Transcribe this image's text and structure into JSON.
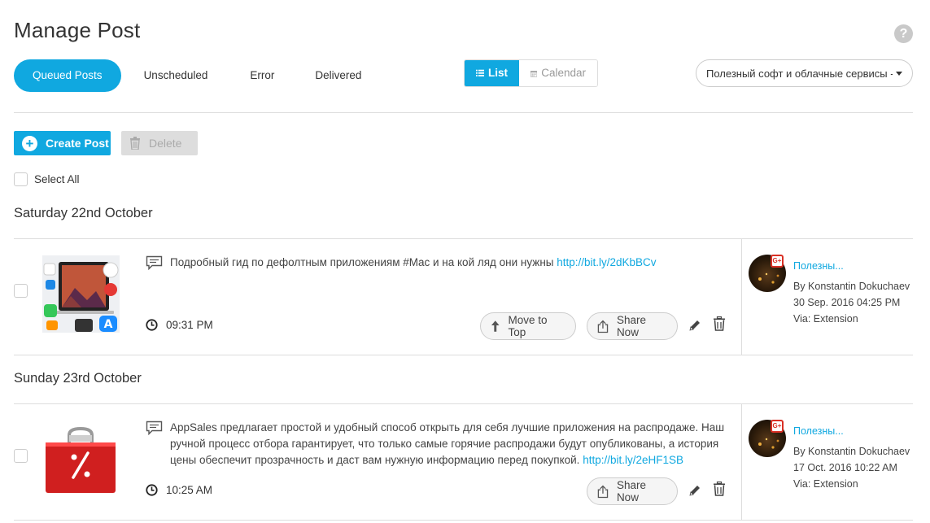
{
  "header": {
    "title": "Manage Post",
    "help_icon": "?"
  },
  "tabs": [
    {
      "label": "Queued Posts",
      "active": true
    },
    {
      "label": "Unscheduled",
      "active": false
    },
    {
      "label": "Error",
      "active": false
    },
    {
      "label": "Delivered",
      "active": false
    }
  ],
  "view_toggle": {
    "list_label": "List",
    "calendar_label": "Calendar",
    "active": "List"
  },
  "account_select": {
    "value": "Полезный софт и облачные сервисы - G"
  },
  "toolbar": {
    "create_label": "Create Post",
    "delete_label": "Delete"
  },
  "select_all_label": "Select All",
  "colors": {
    "accent": "#10a8e0",
    "google_badge": "#d93025"
  },
  "groups": [
    {
      "date": "Saturday 22nd October",
      "posts": [
        {
          "text": "Подробный гид по дефолтным приложениям #Mac и на кой ляд они нужны ",
          "link": "http://bit.ly/2dKbBCv",
          "time": "09:31 PM",
          "move_to_top_label": "Move to Top",
          "share_now_label": "Share Now",
          "account": "Полезны...",
          "author": "By Konstantin Dokuchaev",
          "created": "30 Sep. 2016 04:25 PM",
          "via": "Via: Extension",
          "thumb_icon": "mac-apps-collage"
        }
      ]
    },
    {
      "date": "Sunday 23rd October",
      "posts": [
        {
          "text": "AppSales предлагает простой и удобный способ открыть для себя лучшие приложения на распродаже. Наш ручной процесс отбора гарантирует, что только самые горячие распродажи будут опубликованы, а история цены обеспечит прозрачность и даст вам нужную информацию перед покупкой. ",
          "link": "http://bit.ly/2eHF1SB",
          "time": "10:25 AM",
          "share_now_label": "Share Now",
          "account": "Полезны...",
          "author": "By Konstantin Dokuchaev",
          "created": "17 Oct. 2016 10:22 AM",
          "via": "Via: Extension",
          "thumb_icon": "red-shopping-bag-percent"
        }
      ]
    }
  ]
}
